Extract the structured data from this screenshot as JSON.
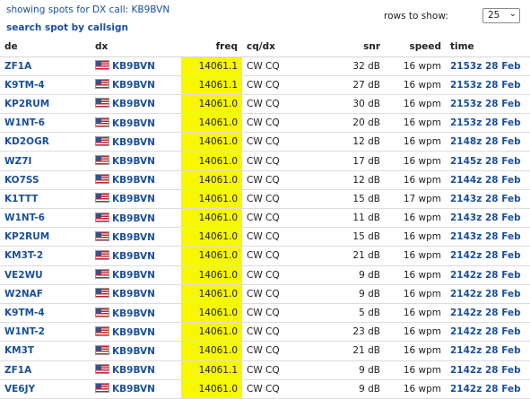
{
  "header": {
    "title": "showing spots for DX call: KB9BVN",
    "search_link": "search spot by callsign",
    "rows_label": "rows to show:",
    "rows_value": "25"
  },
  "columns": [
    "de",
    "dx",
    "freq",
    "cq/dx",
    "snr",
    "speed",
    "time"
  ],
  "spots": [
    {
      "de": "ZF1A",
      "dx": "KB9BVN",
      "freq": "14061.1",
      "mode": "CW CQ",
      "snr": "32 dB",
      "speed": "16 wpm",
      "time": "2153z 28 Feb"
    },
    {
      "de": "K9TM-4",
      "dx": "KB9BVN",
      "freq": "14061.1",
      "mode": "CW CQ",
      "snr": "27 dB",
      "speed": "16 wpm",
      "time": "2153z 28 Feb"
    },
    {
      "de": "KP2RUM",
      "dx": "KB9BVN",
      "freq": "14061.0",
      "mode": "CW CQ",
      "snr": "30 dB",
      "speed": "16 wpm",
      "time": "2153z 28 Feb"
    },
    {
      "de": "W1NT-6",
      "dx": "KB9BVN",
      "freq": "14061.0",
      "mode": "CW CQ",
      "snr": "20 dB",
      "speed": "16 wpm",
      "time": "2153z 28 Feb"
    },
    {
      "de": "KD2OGR",
      "dx": "KB9BVN",
      "freq": "14061.0",
      "mode": "CW CQ",
      "snr": "12 dB",
      "speed": "16 wpm",
      "time": "2148z 28 Feb"
    },
    {
      "de": "WZ7I",
      "dx": "KB9BVN",
      "freq": "14061.0",
      "mode": "CW CQ",
      "snr": "17 dB",
      "speed": "16 wpm",
      "time": "2145z 28 Feb"
    },
    {
      "de": "KO7SS",
      "dx": "KB9BVN",
      "freq": "14061.0",
      "mode": "CW CQ",
      "snr": "12 dB",
      "speed": "16 wpm",
      "time": "2144z 28 Feb"
    },
    {
      "de": "K1TTT",
      "dx": "KB9BVN",
      "freq": "14061.0",
      "mode": "CW CQ",
      "snr": "15 dB",
      "speed": "17 wpm",
      "time": "2143z 28 Feb"
    },
    {
      "de": "W1NT-6",
      "dx": "KB9BVN",
      "freq": "14061.0",
      "mode": "CW CQ",
      "snr": "11 dB",
      "speed": "16 wpm",
      "time": "2143z 28 Feb"
    },
    {
      "de": "KP2RUM",
      "dx": "KB9BVN",
      "freq": "14061.0",
      "mode": "CW CQ",
      "snr": "15 dB",
      "speed": "16 wpm",
      "time": "2143z 28 Feb"
    },
    {
      "de": "KM3T-2",
      "dx": "KB9BVN",
      "freq": "14061.0",
      "mode": "CW CQ",
      "snr": "21 dB",
      "speed": "16 wpm",
      "time": "2142z 28 Feb"
    },
    {
      "de": "VE2WU",
      "dx": "KB9BVN",
      "freq": "14061.0",
      "mode": "CW CQ",
      "snr": "9 dB",
      "speed": "16 wpm",
      "time": "2142z 28 Feb"
    },
    {
      "de": "W2NAF",
      "dx": "KB9BVN",
      "freq": "14061.0",
      "mode": "CW CQ",
      "snr": "9 dB",
      "speed": "16 wpm",
      "time": "2142z 28 Feb"
    },
    {
      "de": "K9TM-4",
      "dx": "KB9BVN",
      "freq": "14061.0",
      "mode": "CW CQ",
      "snr": "5 dB",
      "speed": "16 wpm",
      "time": "2142z 28 Feb"
    },
    {
      "de": "W1NT-2",
      "dx": "KB9BVN",
      "freq": "14061.0",
      "mode": "CW CQ",
      "snr": "23 dB",
      "speed": "16 wpm",
      "time": "2142z 28 Feb"
    },
    {
      "de": "KM3T",
      "dx": "KB9BVN",
      "freq": "14061.0",
      "mode": "CW CQ",
      "snr": "21 dB",
      "speed": "16 wpm",
      "time": "2142z 28 Feb"
    },
    {
      "de": "ZF1A",
      "dx": "KB9BVN",
      "freq": "14061.1",
      "mode": "CW CQ",
      "snr": "9 dB",
      "speed": "16 wpm",
      "time": "2142z 28 Feb"
    },
    {
      "de": "VE6JY",
      "dx": "KB9BVN",
      "freq": "14061.0",
      "mode": "CW CQ",
      "snr": "9 dB",
      "speed": "16 wpm",
      "time": "2142z 28 Feb"
    }
  ],
  "colors": {
    "link": "#1a4f9c",
    "freq_highlight": "#f7f700"
  }
}
